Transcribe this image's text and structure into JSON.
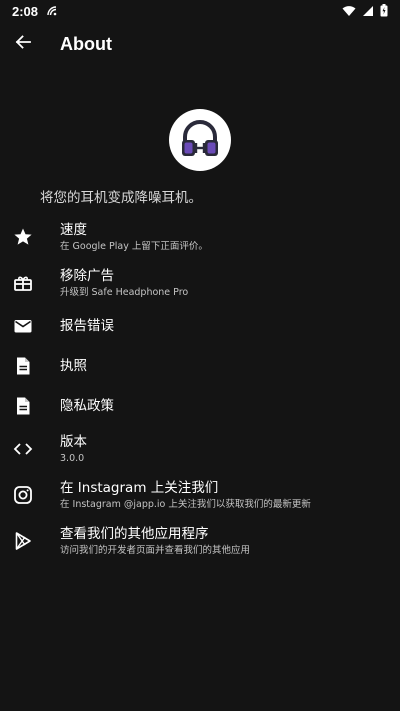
{
  "status_bar": {
    "time": "2:08"
  },
  "app_bar": {
    "title": "About"
  },
  "header": {
    "tagline": "将您的耳机变成降噪耳机。"
  },
  "items": [
    {
      "title": "速度",
      "subtitle": "在 Google Play 上留下正面评价。",
      "icon": "star-icon"
    },
    {
      "title": "移除广告",
      "subtitle": "升级到 Safe Headphone Pro",
      "icon": "gift-icon"
    },
    {
      "title": "报告错误",
      "icon": "mail-icon"
    },
    {
      "title": "执照",
      "icon": "document-icon"
    },
    {
      "title": "隐私政策",
      "icon": "document-icon"
    },
    {
      "title": "版本",
      "subtitle": "3.0.0",
      "icon": "code-icon"
    },
    {
      "title": "在 Instagram 上关注我们",
      "subtitle": "在 Instagram @japp.io 上关注我们以获取我们的最新更新",
      "icon": "instagram-icon"
    },
    {
      "title": "查看我们的其他应用程序",
      "subtitle": "访问我们的开发者页面并查看我们的其他应用",
      "icon": "play-store-icon"
    }
  ],
  "colors": {
    "background": "#141414",
    "logo_bg": "#ffffff",
    "logo_accent": "#6b4bb8"
  }
}
